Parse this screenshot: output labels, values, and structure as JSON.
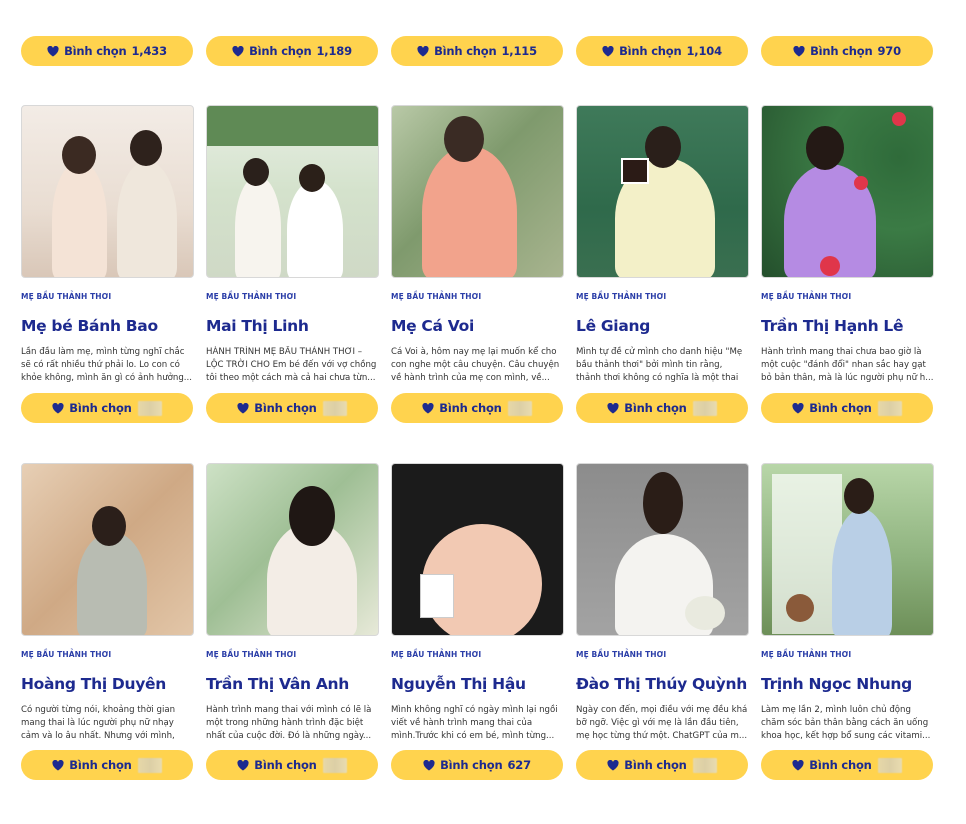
{
  "vote_label": "Bình chọn",
  "top_row_votes": [
    "1,433",
    "1,189",
    "1,115",
    "1,104",
    "970"
  ],
  "colors": {
    "button_bg": "#ffd34e",
    "primary_text": "#1d2a8f",
    "tag_text": "#2b3ea8"
  },
  "cards": [
    {
      "tag": "MẸ BẦU THẢNH THƠI",
      "name": "Mẹ bé Bánh Bao",
      "desc": "Lần đầu làm mẹ, mình từng nghĩ chắc sẽ có rất nhiều thứ phải lo. Lo con có khỏe không, mình ăn gì có ảnh hưởng...",
      "votes": ""
    },
    {
      "tag": "MẸ BẦU THẢNH THƠI",
      "name": "Mai Thị Linh",
      "desc": "HÀNH TRÌNH MẸ BẦU THẢNH THƠI – LỘC TRỜI CHO Em bé đến với vợ chồng tôi theo một cách mà cả hai chưa từn...",
      "votes": ""
    },
    {
      "tag": "MẸ BẦU THẢNH THƠI",
      "name": "Mẹ Cá Voi",
      "desc": "Cá Voi à, hôm nay mẹ lại muốn kể cho con nghe một câu chuyện. Câu chuyện về hành trình của mẹ con mình, về...",
      "votes": ""
    },
    {
      "tag": "MẸ BẦU THẢNH THƠI",
      "name": "Lê Giang",
      "desc": "Mình tự đề cử mình cho danh hiệu \"Mẹ bầu thảnh thơi\" bởi mình tin rằng, thảnh thơi không có nghĩa là một thai kỳ lúc...",
      "votes": ""
    },
    {
      "tag": "MẸ BẦU THẢNH THƠI",
      "name": "Trần Thị Hạnh Lê",
      "desc": "Hành trình mang thai chưa bao giờ là một cuộc \"đánh đổi\" nhan sắc hay gạt bỏ bản thân, mà là lúc người phụ nữ h...",
      "votes": ""
    },
    {
      "tag": "MẸ BẦU THẢNH THƠI",
      "name": "Hoàng Thị Duyên",
      "desc": "Có người từng nói, khoảng thời gian mang thai là lúc người phụ nữ nhạy cảm và lo âu nhất. Nhưng với mình, chín...",
      "votes": ""
    },
    {
      "tag": "MẸ BẦU THẢNH THƠI",
      "name": "Trần Thị Vân Anh",
      "desc": "Hành trình mang thai với mình có lẽ là một trong những hành trình đặc biệt nhất của cuộc đời. Đó là những ngày...",
      "votes": ""
    },
    {
      "tag": "MẸ BẦU THẢNH THƠI",
      "name": "Nguyễn Thị Hậu",
      "desc": "Mình không nghĩ có ngày mình lại ngồi viết về hành trình mang thai của mình.Trước khi có em bé, mình từng...",
      "votes": "627"
    },
    {
      "tag": "MẸ BẦU THẢNH THƠI",
      "name": "Đào Thị Thúy Quỳnh",
      "desc": "Ngày con đến, mọi điều với mẹ đều khá bỡ ngỡ. Việc gì với mẹ là lần đầu tiên, mẹ học từng thứ một. ChatGPT của m...",
      "votes": ""
    },
    {
      "tag": "MẸ BẦU THẢNH THƠI",
      "name": "Trịnh Ngọc Nhung",
      "desc": "Làm mẹ lần 2, mình luôn chủ động chăm sóc bản thân bằng cách ăn uống khoa học, kết hợp bổ sung các vitami...",
      "votes": ""
    }
  ]
}
